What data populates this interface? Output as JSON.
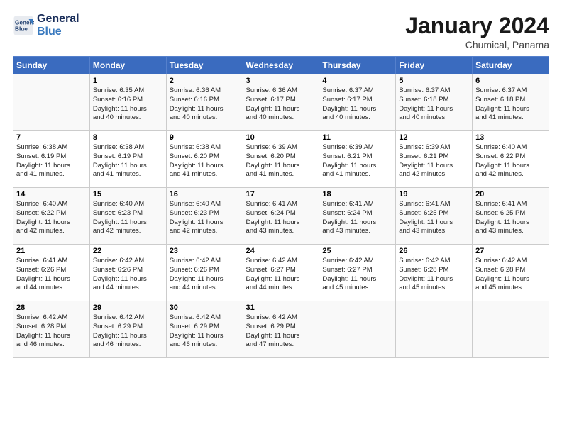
{
  "header": {
    "logo_line1": "General",
    "logo_line2": "Blue",
    "title": "January 2024",
    "subtitle": "Chumical, Panama"
  },
  "weekdays": [
    "Sunday",
    "Monday",
    "Tuesday",
    "Wednesday",
    "Thursday",
    "Friday",
    "Saturday"
  ],
  "weeks": [
    [
      {
        "day": "",
        "info": ""
      },
      {
        "day": "1",
        "info": "Sunrise: 6:35 AM\nSunset: 6:16 PM\nDaylight: 11 hours\nand 40 minutes."
      },
      {
        "day": "2",
        "info": "Sunrise: 6:36 AM\nSunset: 6:16 PM\nDaylight: 11 hours\nand 40 minutes."
      },
      {
        "day": "3",
        "info": "Sunrise: 6:36 AM\nSunset: 6:17 PM\nDaylight: 11 hours\nand 40 minutes."
      },
      {
        "day": "4",
        "info": "Sunrise: 6:37 AM\nSunset: 6:17 PM\nDaylight: 11 hours\nand 40 minutes."
      },
      {
        "day": "5",
        "info": "Sunrise: 6:37 AM\nSunset: 6:18 PM\nDaylight: 11 hours\nand 40 minutes."
      },
      {
        "day": "6",
        "info": "Sunrise: 6:37 AM\nSunset: 6:18 PM\nDaylight: 11 hours\nand 41 minutes."
      }
    ],
    [
      {
        "day": "7",
        "info": "Sunrise: 6:38 AM\nSunset: 6:19 PM\nDaylight: 11 hours\nand 41 minutes."
      },
      {
        "day": "8",
        "info": "Sunrise: 6:38 AM\nSunset: 6:19 PM\nDaylight: 11 hours\nand 41 minutes."
      },
      {
        "day": "9",
        "info": "Sunrise: 6:38 AM\nSunset: 6:20 PM\nDaylight: 11 hours\nand 41 minutes."
      },
      {
        "day": "10",
        "info": "Sunrise: 6:39 AM\nSunset: 6:20 PM\nDaylight: 11 hours\nand 41 minutes."
      },
      {
        "day": "11",
        "info": "Sunrise: 6:39 AM\nSunset: 6:21 PM\nDaylight: 11 hours\nand 41 minutes."
      },
      {
        "day": "12",
        "info": "Sunrise: 6:39 AM\nSunset: 6:21 PM\nDaylight: 11 hours\nand 42 minutes."
      },
      {
        "day": "13",
        "info": "Sunrise: 6:40 AM\nSunset: 6:22 PM\nDaylight: 11 hours\nand 42 minutes."
      }
    ],
    [
      {
        "day": "14",
        "info": "Sunrise: 6:40 AM\nSunset: 6:22 PM\nDaylight: 11 hours\nand 42 minutes."
      },
      {
        "day": "15",
        "info": "Sunrise: 6:40 AM\nSunset: 6:23 PM\nDaylight: 11 hours\nand 42 minutes."
      },
      {
        "day": "16",
        "info": "Sunrise: 6:40 AM\nSunset: 6:23 PM\nDaylight: 11 hours\nand 42 minutes."
      },
      {
        "day": "17",
        "info": "Sunrise: 6:41 AM\nSunset: 6:24 PM\nDaylight: 11 hours\nand 43 minutes."
      },
      {
        "day": "18",
        "info": "Sunrise: 6:41 AM\nSunset: 6:24 PM\nDaylight: 11 hours\nand 43 minutes."
      },
      {
        "day": "19",
        "info": "Sunrise: 6:41 AM\nSunset: 6:25 PM\nDaylight: 11 hours\nand 43 minutes."
      },
      {
        "day": "20",
        "info": "Sunrise: 6:41 AM\nSunset: 6:25 PM\nDaylight: 11 hours\nand 43 minutes."
      }
    ],
    [
      {
        "day": "21",
        "info": "Sunrise: 6:41 AM\nSunset: 6:26 PM\nDaylight: 11 hours\nand 44 minutes."
      },
      {
        "day": "22",
        "info": "Sunrise: 6:42 AM\nSunset: 6:26 PM\nDaylight: 11 hours\nand 44 minutes."
      },
      {
        "day": "23",
        "info": "Sunrise: 6:42 AM\nSunset: 6:26 PM\nDaylight: 11 hours\nand 44 minutes."
      },
      {
        "day": "24",
        "info": "Sunrise: 6:42 AM\nSunset: 6:27 PM\nDaylight: 11 hours\nand 44 minutes."
      },
      {
        "day": "25",
        "info": "Sunrise: 6:42 AM\nSunset: 6:27 PM\nDaylight: 11 hours\nand 45 minutes."
      },
      {
        "day": "26",
        "info": "Sunrise: 6:42 AM\nSunset: 6:28 PM\nDaylight: 11 hours\nand 45 minutes."
      },
      {
        "day": "27",
        "info": "Sunrise: 6:42 AM\nSunset: 6:28 PM\nDaylight: 11 hours\nand 45 minutes."
      }
    ],
    [
      {
        "day": "28",
        "info": "Sunrise: 6:42 AM\nSunset: 6:28 PM\nDaylight: 11 hours\nand 46 minutes."
      },
      {
        "day": "29",
        "info": "Sunrise: 6:42 AM\nSunset: 6:29 PM\nDaylight: 11 hours\nand 46 minutes."
      },
      {
        "day": "30",
        "info": "Sunrise: 6:42 AM\nSunset: 6:29 PM\nDaylight: 11 hours\nand 46 minutes."
      },
      {
        "day": "31",
        "info": "Sunrise: 6:42 AM\nSunset: 6:29 PM\nDaylight: 11 hours\nand 47 minutes."
      },
      {
        "day": "",
        "info": ""
      },
      {
        "day": "",
        "info": ""
      },
      {
        "day": "",
        "info": ""
      }
    ]
  ]
}
